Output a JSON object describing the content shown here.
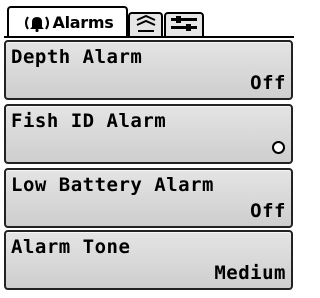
{
  "tabs": {
    "alarms": {
      "label": "Alarms",
      "icon": "bell-icon"
    },
    "sonar": {
      "icon": "sonar-icon"
    },
    "setup": {
      "icon": "setup-icon"
    }
  },
  "menu": {
    "items": [
      {
        "label": "Depth Alarm",
        "value": "Off"
      },
      {
        "label": "Fish ID Alarm",
        "value": "",
        "icon": "radio-off-icon"
      },
      {
        "label": "Low Battery Alarm",
        "value": "Off"
      },
      {
        "label": "Alarm Tone",
        "value": "Medium"
      }
    ]
  },
  "colors": {
    "item_background": "#d8d8d8",
    "border": "#000000",
    "tab_inactive": "#e6e6e6"
  }
}
